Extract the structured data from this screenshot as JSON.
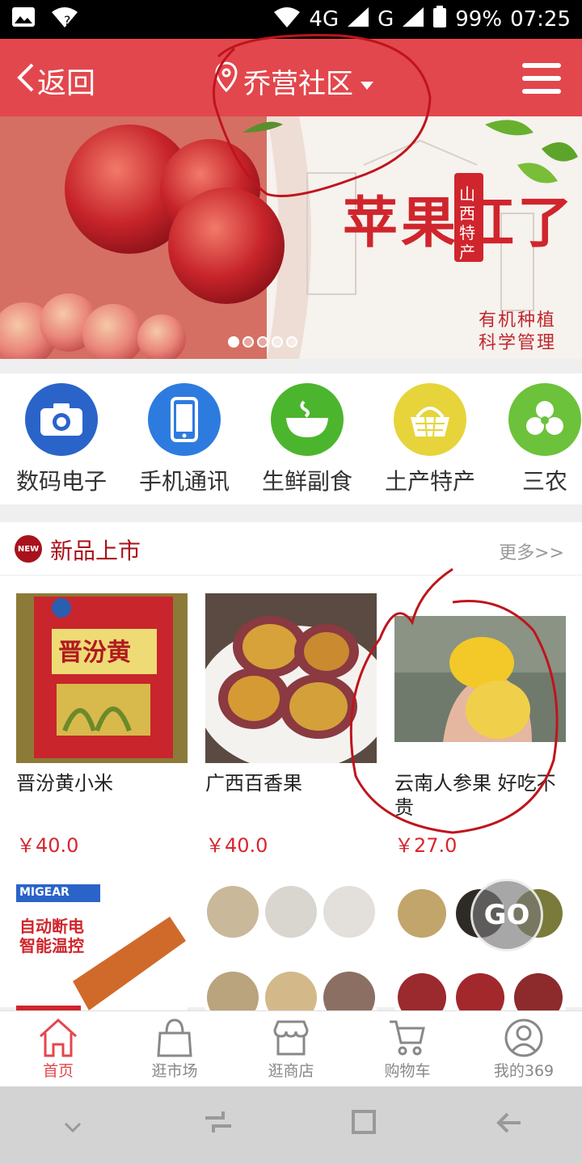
{
  "status_bar": {
    "network_4g": "4G",
    "network_g": "G",
    "battery": "99%",
    "time": "07:25"
  },
  "header": {
    "back_label": "返回",
    "location": "乔营社区"
  },
  "banner": {
    "headline": "苹果红了",
    "tag": "山西特产",
    "slogan_line1": "有机种植",
    "slogan_line2": "科学管理",
    "dots": 5,
    "active_dot": 0
  },
  "categories": [
    {
      "label": "数码电子",
      "icon": "camera-icon",
      "color": "#2a64c9"
    },
    {
      "label": "手机通讯",
      "icon": "phone-icon",
      "color": "#2e7be0"
    },
    {
      "label": "生鲜副食",
      "icon": "bowl-icon",
      "color": "#4cb52e"
    },
    {
      "label": "土产特产",
      "icon": "basket-icon",
      "color": "#e6d43a"
    },
    {
      "label": "三农",
      "icon": "leaf-icon",
      "color": "#6cc23a"
    }
  ],
  "new_products": {
    "badge": "NEW",
    "title": "新品上市",
    "more": "更多>>",
    "items": [
      {
        "name": "晋汾黄小米",
        "price": "￥40.0"
      },
      {
        "name": "广西百香果",
        "price": "￥40.0"
      },
      {
        "name": "云南人参果 好吃不贵",
        "price": "￥27.0"
      }
    ],
    "row2": [
      {
        "caption_top": "MIGEAR",
        "caption_a": "自动断电",
        "caption_b": "智能温控"
      },
      {},
      {}
    ]
  },
  "go_button": "GO",
  "tabbar": [
    {
      "label": "首页",
      "active": true
    },
    {
      "label": "逛市场",
      "active": false
    },
    {
      "label": "逛商店",
      "active": false
    },
    {
      "label": "购物车",
      "active": false
    },
    {
      "label": "我的369",
      "active": false
    }
  ],
  "colors": {
    "brand_red": "#e2474d",
    "price_red": "#d9262e",
    "new_red": "#a8121c"
  }
}
